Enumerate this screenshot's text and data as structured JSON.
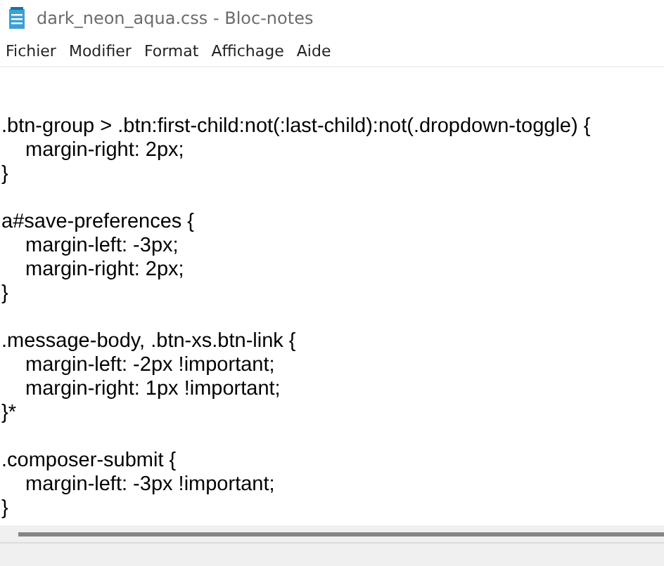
{
  "window": {
    "title": "dark_neon_aqua.css - Bloc-notes"
  },
  "menu": [
    "Fichier",
    "Modifier",
    "Format",
    "Affichage",
    "Aide"
  ],
  "editor": {
    "blocks": [
      [
        {
          "kind": "selector",
          "text": ".btn-group > .btn:first-child:not(:last-child):not(.dropdown-toggle) {"
        },
        {
          "kind": "property",
          "text": "margin-right: 2px;"
        },
        {
          "kind": "close",
          "text": "}"
        }
      ],
      [
        {
          "kind": "selector",
          "text": "a#save-preferences {"
        },
        {
          "kind": "property",
          "text": "margin-left: -3px;"
        },
        {
          "kind": "property",
          "text": "margin-right: 2px;"
        },
        {
          "kind": "close",
          "text": "}"
        }
      ],
      [
        {
          "kind": "selector",
          "text": ".message-body, .btn-xs.btn-link {"
        },
        {
          "kind": "property",
          "text": "margin-left: -2px !important;"
        },
        {
          "kind": "property",
          "text": "margin-right: 1px !important;"
        },
        {
          "kind": "close",
          "text": "}*"
        }
      ],
      [
        {
          "kind": "selector",
          "text": ".composer-submit {"
        },
        {
          "kind": "property",
          "text": "margin-left: -3px !important;"
        },
        {
          "kind": "close",
          "text": "}"
        }
      ]
    ]
  }
}
